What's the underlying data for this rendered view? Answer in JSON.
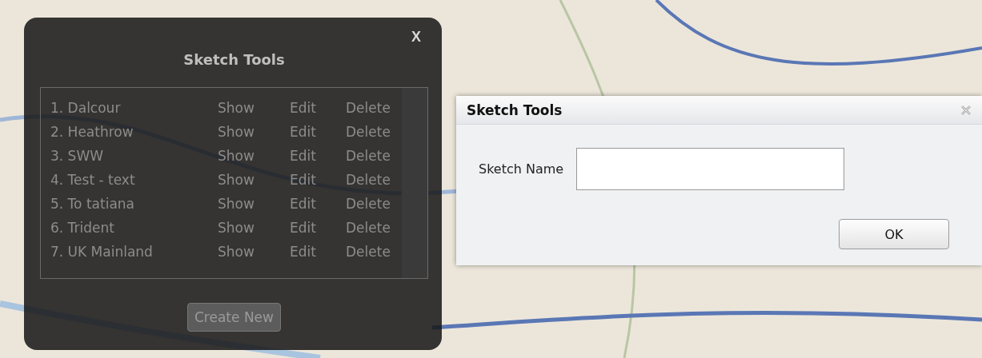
{
  "sketch_panel": {
    "title": "Sketch Tools",
    "close": "X",
    "sketches": [
      {
        "name": "1. Dalcour",
        "actions": [
          "Show",
          "Edit",
          "Delete"
        ]
      },
      {
        "name": "2. Heathrow",
        "actions": [
          "Show",
          "Edit",
          "Delete"
        ]
      },
      {
        "name": "3. SWW",
        "actions": [
          "Show",
          "Edit",
          "Delete"
        ]
      },
      {
        "name": "4. Test - text",
        "actions": [
          "Show",
          "Edit",
          "Delete"
        ]
      },
      {
        "name": "5. To tatiana",
        "actions": [
          "Show",
          "Edit",
          "Delete"
        ]
      },
      {
        "name": "6. Trident",
        "actions": [
          "Show",
          "Edit",
          "Delete"
        ]
      },
      {
        "name": "7. UK Mainland",
        "actions": [
          "Show",
          "Edit",
          "Delete"
        ]
      }
    ],
    "create_button": {
      "label": "Create New",
      "disabled": true
    }
  },
  "dialog": {
    "title": "Sketch Tools",
    "field": {
      "label": "Sketch Name"
    },
    "ok_button": "OK"
  }
}
